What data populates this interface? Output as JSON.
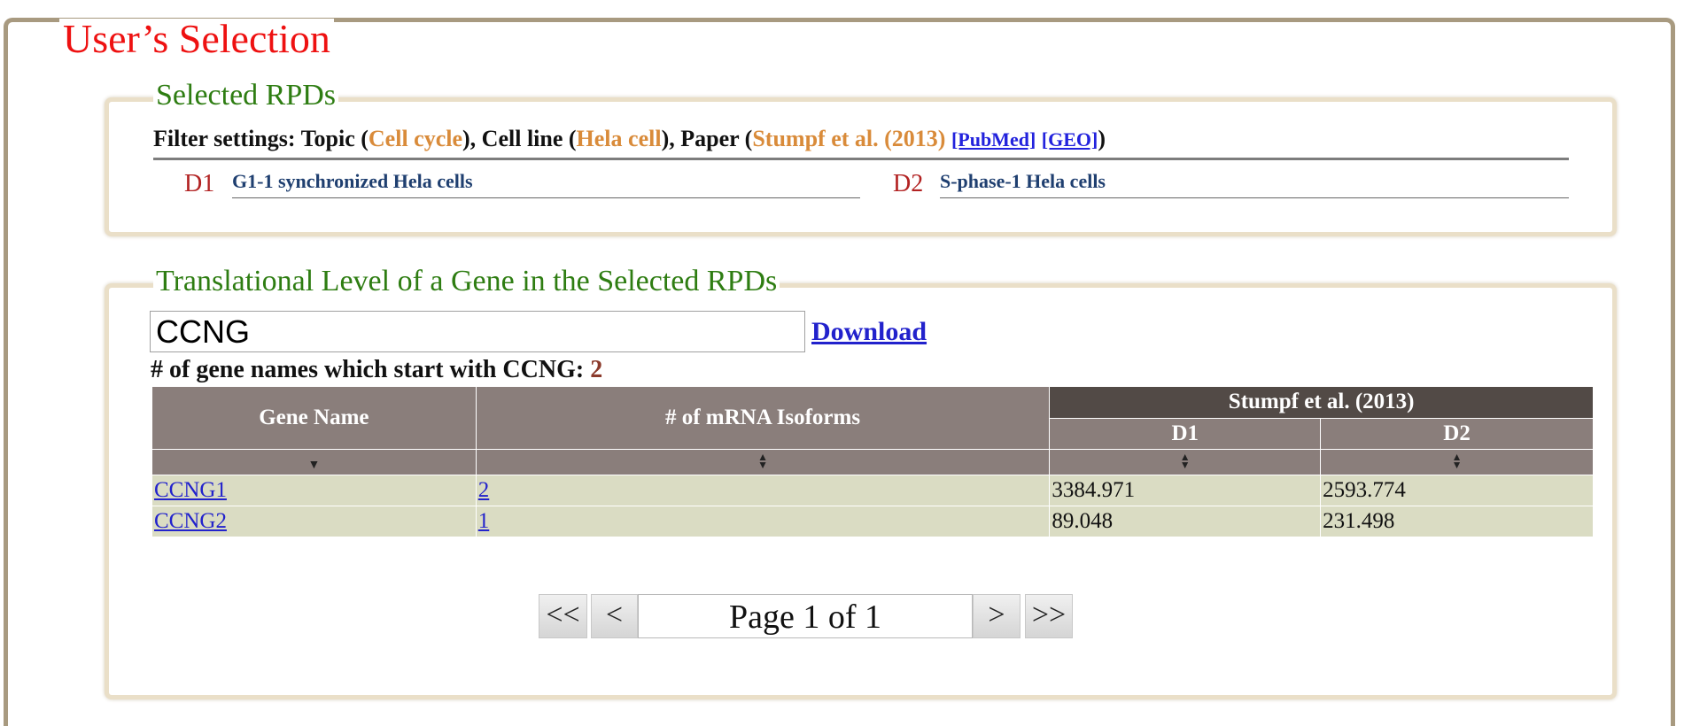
{
  "page_title": "User’s Selection",
  "selected_panel": {
    "legend": "Selected RPDs",
    "filter": {
      "prefix": "Filter settings: Topic (",
      "topic": "Cell cycle",
      "sep1": "), Cell line (",
      "cell_line": "Hela cell",
      "sep2": "), Paper (",
      "paper": "Stumpf et al. (2013)",
      "pubmed": "[PubMed]",
      "geo": "[GEO]",
      "suffix": ")"
    },
    "datasets": [
      {
        "id": "D1",
        "name": "G1-1 synchronized Hela cells"
      },
      {
        "id": "D2",
        "name": "S-phase-1 Hela cells"
      }
    ]
  },
  "gene_panel": {
    "legend": "Translational Level of a Gene in the Selected RPDs",
    "search_value": "CCNG",
    "download_label": "Download",
    "count_label": "# of gene names which start with CCNG: ",
    "count_value": "2",
    "table": {
      "headers": {
        "gene": "Gene Name",
        "isoforms": "# of mRNA Isoforms",
        "group": "Stumpf et al. (2013)",
        "d1": "D1",
        "d2": "D2"
      },
      "rows": [
        {
          "gene": "CCNG1",
          "isoforms": "2",
          "d1": "3384.971",
          "d2": "2593.774"
        },
        {
          "gene": "CCNG2",
          "isoforms": "1",
          "d1": "89.048",
          "d2": "231.498"
        }
      ]
    },
    "pager": {
      "first": "<<",
      "prev": "<",
      "display": "Page 1 of 1",
      "next": ">",
      "last": ">>"
    }
  },
  "icons": {
    "sort_desc": "sort-desc-icon",
    "sort_both": "sort-both-icon"
  }
}
